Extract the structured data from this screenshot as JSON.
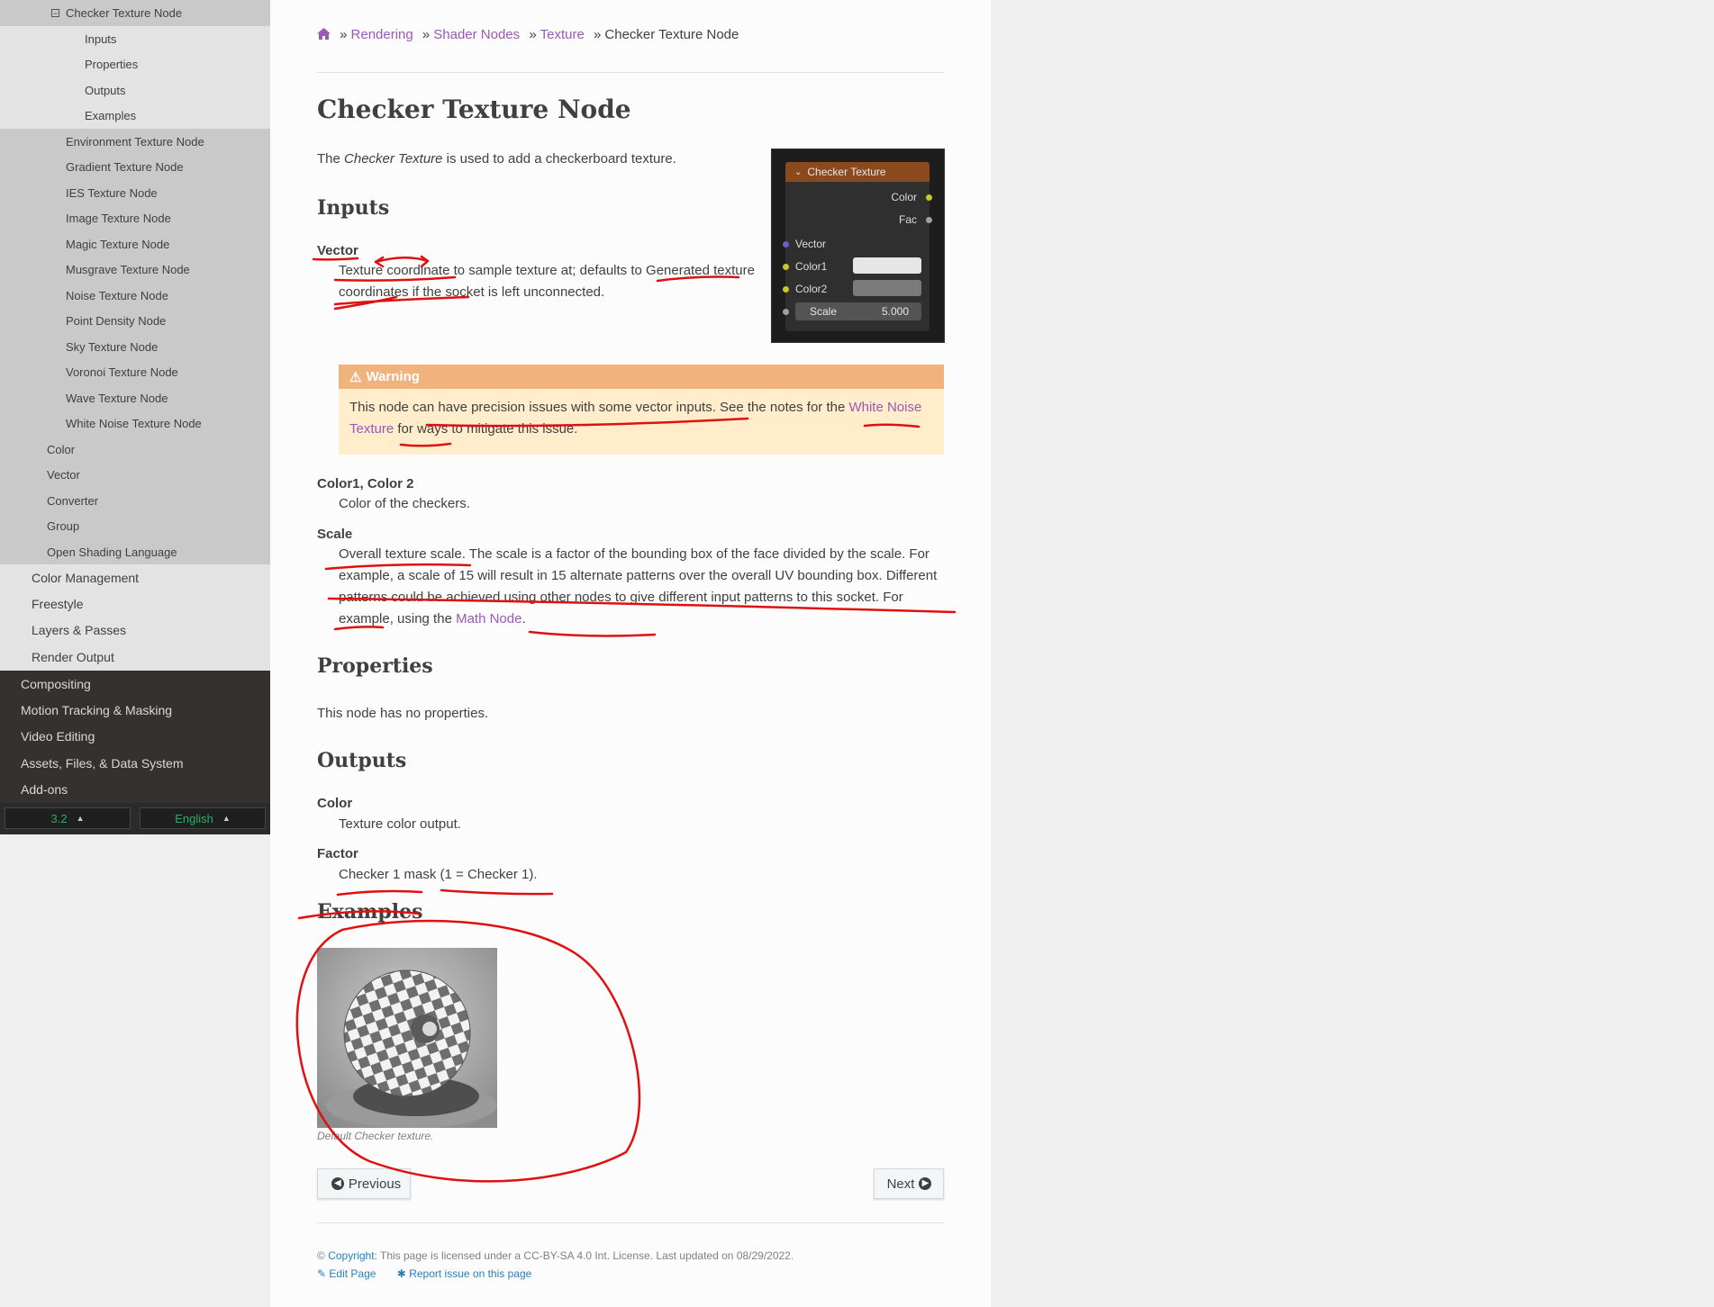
{
  "sidebar": {
    "items": [
      {
        "label": "Checker Texture Node",
        "level": "current"
      },
      {
        "label": "Inputs",
        "level": "l4"
      },
      {
        "label": "Properties",
        "level": "l4"
      },
      {
        "label": "Outputs",
        "level": "l4"
      },
      {
        "label": "Examples",
        "level": "l4"
      },
      {
        "label": "Environment Texture Node",
        "level": "l3"
      },
      {
        "label": "Gradient Texture Node",
        "level": "l3"
      },
      {
        "label": "IES Texture Node",
        "level": "l3"
      },
      {
        "label": "Image Texture Node",
        "level": "l3"
      },
      {
        "label": "Magic Texture Node",
        "level": "l3"
      },
      {
        "label": "Musgrave Texture Node",
        "level": "l3"
      },
      {
        "label": "Noise Texture Node",
        "level": "l3"
      },
      {
        "label": "Point Density Node",
        "level": "l3"
      },
      {
        "label": "Sky Texture Node",
        "level": "l3"
      },
      {
        "label": "Voronoi Texture Node",
        "level": "l3"
      },
      {
        "label": "Wave Texture Node",
        "level": "l3"
      },
      {
        "label": "White Noise Texture Node",
        "level": "l3"
      },
      {
        "label": "Color",
        "level": "l2"
      },
      {
        "label": "Vector",
        "level": "l2"
      },
      {
        "label": "Converter",
        "level": "l2"
      },
      {
        "label": "Group",
        "level": "l2"
      },
      {
        "label": "Open Shading Language",
        "level": "l2"
      },
      {
        "label": "Color Management",
        "level": "l1"
      },
      {
        "label": "Freestyle",
        "level": "l1"
      },
      {
        "label": "Layers & Passes",
        "level": "l1"
      },
      {
        "label": "Render Output",
        "level": "l1"
      },
      {
        "label": "Compositing",
        "level": "top"
      },
      {
        "label": "Motion Tracking & Masking",
        "level": "top"
      },
      {
        "label": "Video Editing",
        "level": "top"
      },
      {
        "label": "Assets, Files, & Data System",
        "level": "top"
      },
      {
        "label": "Add-ons",
        "level": "top"
      }
    ],
    "version": "3.2",
    "language": "English"
  },
  "breadcrumb": {
    "items": [
      "Rendering",
      "Shader Nodes",
      "Texture"
    ],
    "current": "Checker Texture Node"
  },
  "page": {
    "title": "Checker Texture Node",
    "intro_pre": "The ",
    "intro_em": "Checker Texture",
    "intro_post": " is used to add a checkerboard texture."
  },
  "node": {
    "title": "Checker Texture",
    "out_color": "Color",
    "out_fac": "Fac",
    "in_vector": "Vector",
    "in_color1": "Color1",
    "in_color2": "Color2",
    "scale_label": "Scale",
    "scale_value": "5.000"
  },
  "inputs": {
    "heading": "Inputs",
    "vector_term": "Vector",
    "vector_desc": "Texture coordinate to sample texture at; defaults to Generated texture coordinates if the socket is left unconnected.",
    "warning_title": "Warning",
    "warning_text": "This node can have precision issues with some vector inputs. See the notes for the ",
    "warning_link": "White Noise Texture",
    "warning_post": " for ways to mitigate this issue.",
    "colors_term": "Color1, Color 2",
    "colors_desc": "Color of the checkers.",
    "scale_term": "Scale",
    "scale_desc": "Overall texture scale. The scale is a factor of the bounding box of the face divided by the scale. For example, a scale of 15 will result in 15 alternate patterns over the overall UV bounding box. Different patterns could be achieved using other nodes to give different input patterns to this socket. For example, using the ",
    "scale_link": "Math Node",
    "scale_post": "."
  },
  "properties": {
    "heading": "Properties",
    "text": "This node has no properties."
  },
  "outputs": {
    "heading": "Outputs",
    "color_term": "Color",
    "color_desc": "Texture color output.",
    "factor_term": "Factor",
    "factor_desc": "Checker 1 mask (1 = Checker 1)."
  },
  "examples": {
    "heading": "Examples",
    "caption": "Default Checker texture."
  },
  "nav": {
    "previous": "Previous",
    "next": "Next"
  },
  "footer": {
    "copyright_symbol": "©",
    "copyright_link": "Copyright",
    "license_text": ": This page is licensed under a CC-BY-SA 4.0 Int. License. Last updated on 08/29/2022.",
    "edit_page": "Edit Page",
    "report_issue": "Report issue on this page"
  },
  "colors": {
    "link": "#9b59b6",
    "sidebar_dark": "#343131",
    "warning_title_bg": "#f0b37e",
    "warning_body_bg": "#ffedcc",
    "version_green": "#27ae60",
    "annotation_red": "#e01010"
  }
}
